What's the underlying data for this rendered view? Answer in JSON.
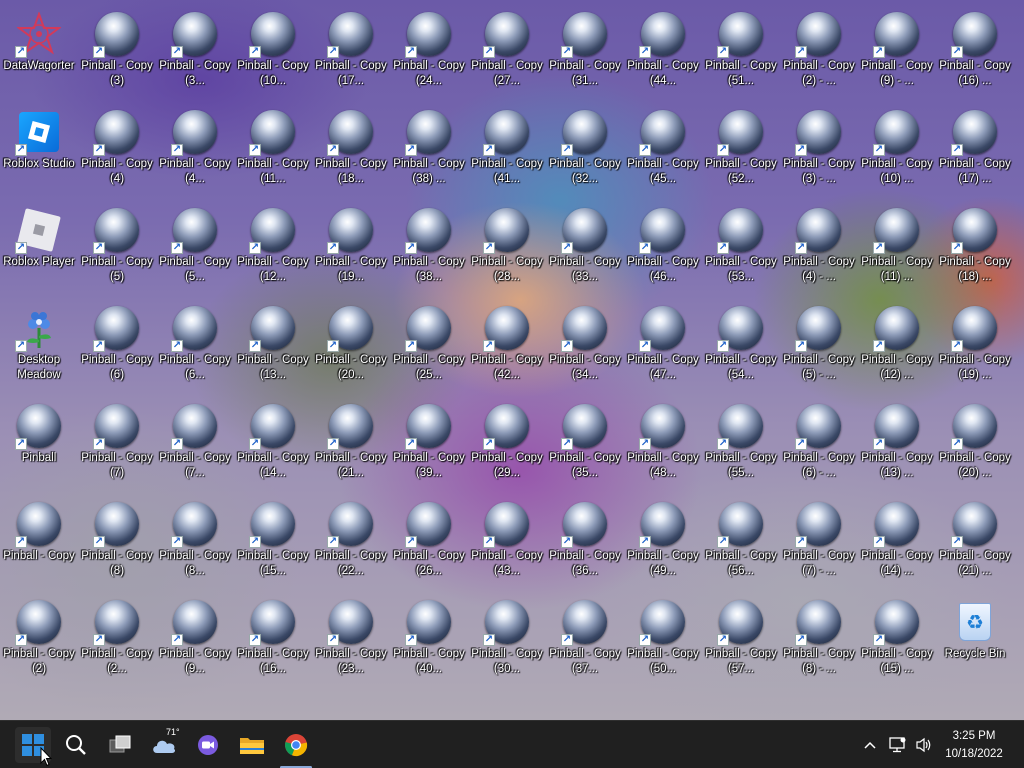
{
  "desktop": {
    "icons": [
      {
        "label": "DataWagorter",
        "type": "logo"
      },
      {
        "label": "Roblox Studio",
        "type": "studio"
      },
      {
        "label": "Roblox Player",
        "type": "player"
      },
      {
        "label": "Desktop Meadow",
        "type": "meadow"
      },
      {
        "label": "Pinball",
        "type": "pinball"
      },
      {
        "label": "Pinball - Copy",
        "type": "pinball"
      },
      {
        "label": "Pinball - Copy (2)",
        "type": "pinball"
      },
      {
        "label": "Pinball - Copy (3)",
        "type": "pinball"
      },
      {
        "label": "Pinball - Copy (4)",
        "type": "pinball"
      },
      {
        "label": "Pinball - Copy (5)",
        "type": "pinball"
      },
      {
        "label": "Pinball - Copy (6)",
        "type": "pinball"
      },
      {
        "label": "Pinball - Copy (7)",
        "type": "pinball"
      },
      {
        "label": "Pinball - Copy (8)",
        "type": "pinball"
      },
      {
        "label": "Pinball - Copy (2...",
        "type": "pinball"
      },
      {
        "label": "Pinball - Copy (3...",
        "type": "pinball"
      },
      {
        "label": "Pinball - Copy (4...",
        "type": "pinball"
      },
      {
        "label": "Pinball - Copy (5...",
        "type": "pinball"
      },
      {
        "label": "Pinball - Copy (6...",
        "type": "pinball"
      },
      {
        "label": "Pinball - Copy (7...",
        "type": "pinball"
      },
      {
        "label": "Pinball - Copy (8...",
        "type": "pinball"
      },
      {
        "label": "Pinball - Copy (9...",
        "type": "pinball"
      },
      {
        "label": "Pinball - Copy (10...",
        "type": "pinball"
      },
      {
        "label": "Pinball - Copy (11...",
        "type": "pinball"
      },
      {
        "label": "Pinball - Copy (12...",
        "type": "pinball"
      },
      {
        "label": "Pinball - Copy (13...",
        "type": "pinball"
      },
      {
        "label": "Pinball - Copy (14...",
        "type": "pinball"
      },
      {
        "label": "Pinball - Copy (15...",
        "type": "pinball"
      },
      {
        "label": "Pinball - Copy (16...",
        "type": "pinball"
      },
      {
        "label": "Pinball - Copy (17...",
        "type": "pinball"
      },
      {
        "label": "Pinball - Copy (18...",
        "type": "pinball"
      },
      {
        "label": "Pinball - Copy (19...",
        "type": "pinball"
      },
      {
        "label": "Pinball - Copy (20...",
        "type": "pinball"
      },
      {
        "label": "Pinball - Copy (21...",
        "type": "pinball"
      },
      {
        "label": "Pinball - Copy (22...",
        "type": "pinball"
      },
      {
        "label": "Pinball - Copy (23...",
        "type": "pinball"
      },
      {
        "label": "Pinball - Copy (24...",
        "type": "pinball"
      },
      {
        "label": "Pinball - Copy (38) ...",
        "type": "pinball"
      },
      {
        "label": "Pinball - Copy (38...",
        "type": "pinball"
      },
      {
        "label": "Pinball - Copy (25...",
        "type": "pinball"
      },
      {
        "label": "Pinball - Copy (39...",
        "type": "pinball"
      },
      {
        "label": "Pinball - Copy (26...",
        "type": "pinball"
      },
      {
        "label": "Pinball - Copy (40...",
        "type": "pinball"
      },
      {
        "label": "Pinball - Copy (27...",
        "type": "pinball"
      },
      {
        "label": "Pinball - Copy (41...",
        "type": "pinball"
      },
      {
        "label": "Pinball - Copy (28...",
        "type": "pinball"
      },
      {
        "label": "Pinball - Copy (42...",
        "type": "pinball"
      },
      {
        "label": "Pinball - Copy (29...",
        "type": "pinball"
      },
      {
        "label": "Pinball - Copy (43...",
        "type": "pinball"
      },
      {
        "label": "Pinball - Copy (30...",
        "type": "pinball"
      },
      {
        "label": "Pinball - Copy (31...",
        "type": "pinball"
      },
      {
        "label": "Pinball - Copy (32...",
        "type": "pinball"
      },
      {
        "label": "Pinball - Copy (33...",
        "type": "pinball"
      },
      {
        "label": "Pinball - Copy (34...",
        "type": "pinball"
      },
      {
        "label": "Pinball - Copy (35...",
        "type": "pinball"
      },
      {
        "label": "Pinball - Copy (36...",
        "type": "pinball"
      },
      {
        "label": "Pinball - Copy (37...",
        "type": "pinball"
      },
      {
        "label": "Pinball - Copy (44...",
        "type": "pinball"
      },
      {
        "label": "Pinball - Copy (45...",
        "type": "pinball"
      },
      {
        "label": "Pinball - Copy (46...",
        "type": "pinball"
      },
      {
        "label": "Pinball - Copy (47...",
        "type": "pinball"
      },
      {
        "label": "Pinball - Copy (48...",
        "type": "pinball"
      },
      {
        "label": "Pinball - Copy (49...",
        "type": "pinball"
      },
      {
        "label": "Pinball - Copy (50...",
        "type": "pinball"
      },
      {
        "label": "Pinball - Copy (51...",
        "type": "pinball"
      },
      {
        "label": "Pinball - Copy (52...",
        "type": "pinball"
      },
      {
        "label": "Pinball - Copy (53...",
        "type": "pinball"
      },
      {
        "label": "Pinball - Copy (54...",
        "type": "pinball"
      },
      {
        "label": "Pinball - Copy (55...",
        "type": "pinball"
      },
      {
        "label": "Pinball - Copy (56...",
        "type": "pinball"
      },
      {
        "label": "Pinball - Copy (57...",
        "type": "pinball"
      },
      {
        "label": "Pinball - Copy (2) - ...",
        "type": "pinball"
      },
      {
        "label": "Pinball - Copy (3) - ...",
        "type": "pinball"
      },
      {
        "label": "Pinball - Copy (4) - ...",
        "type": "pinball"
      },
      {
        "label": "Pinball - Copy (5) - ...",
        "type": "pinball"
      },
      {
        "label": "Pinball - Copy (6) - ...",
        "type": "pinball"
      },
      {
        "label": "Pinball - Copy (7) - ...",
        "type": "pinball"
      },
      {
        "label": "Pinball - Copy (8) - ...",
        "type": "pinball"
      },
      {
        "label": "Pinball - Copy (9) - ...",
        "type": "pinball"
      },
      {
        "label": "Pinball - Copy (10) ...",
        "type": "pinball"
      },
      {
        "label": "Pinball - Copy (11) ...",
        "type": "pinball"
      },
      {
        "label": "Pinball - Copy (12) ...",
        "type": "pinball"
      },
      {
        "label": "Pinball - Copy (13) ...",
        "type": "pinball"
      },
      {
        "label": "Pinball - Copy (14) ...",
        "type": "pinball"
      },
      {
        "label": "Pinball - Copy (15) ...",
        "type": "pinball"
      },
      {
        "label": "Pinball - Copy (16) ...",
        "type": "pinball"
      },
      {
        "label": "Pinball - Copy (17) ...",
        "type": "pinball"
      },
      {
        "label": "Pinball - Copy (18) ...",
        "type": "pinball"
      },
      {
        "label": "Pinball - Copy (19) ...",
        "type": "pinball"
      },
      {
        "label": "Pinball - Copy (20) ...",
        "type": "pinball"
      },
      {
        "label": "Pinball - Copy (21) ...",
        "type": "pinball"
      },
      {
        "label": "Recycle Bin",
        "type": "bin"
      }
    ]
  },
  "taskbar": {
    "buttons": [
      {
        "name": "start-button",
        "icon": "windows-logo-icon"
      },
      {
        "name": "search-button",
        "icon": "search-icon"
      },
      {
        "name": "task-view-button",
        "icon": "task-view-icon"
      },
      {
        "name": "weather-widget-button",
        "icon": "cloud-icon",
        "temp": "71°"
      },
      {
        "name": "chat-button",
        "icon": "video-chat-icon"
      },
      {
        "name": "file-explorer-button",
        "icon": "folder-icon"
      },
      {
        "name": "chrome-button",
        "icon": "chrome-icon"
      }
    ],
    "tray": {
      "chevron": "^",
      "time": "3:25 PM",
      "date": "10/18/2022"
    }
  }
}
